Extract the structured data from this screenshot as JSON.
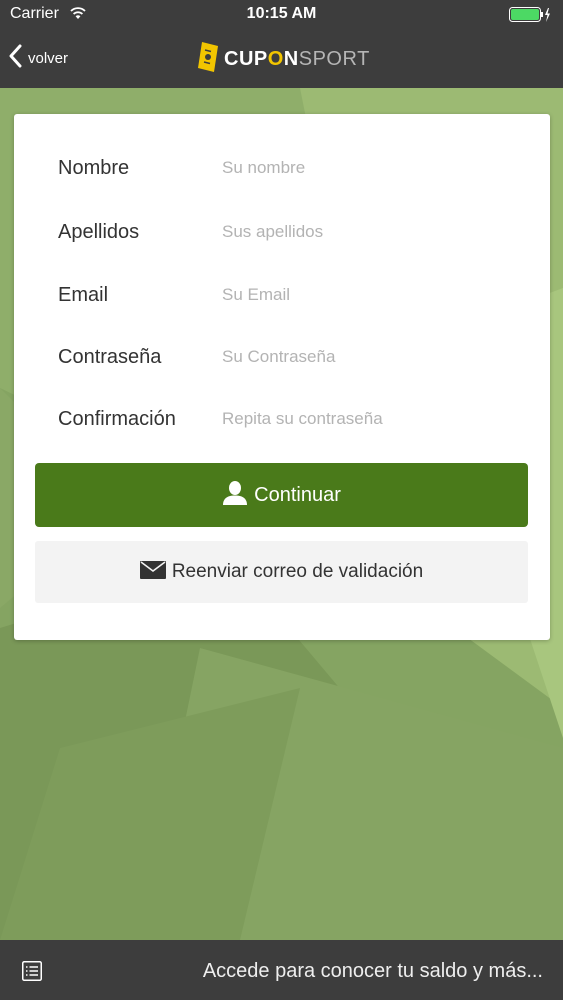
{
  "status_bar": {
    "carrier": "Carrier",
    "time": "10:15 AM"
  },
  "nav": {
    "back_label": "volver",
    "brand_part1": "CUP",
    "brand_o": "O",
    "brand_part2": "N",
    "brand_sport": "SPORT"
  },
  "form": {
    "fields": [
      {
        "label": "Nombre",
        "placeholder": "Su nombre"
      },
      {
        "label": "Apellidos",
        "placeholder": "Sus apellidos"
      },
      {
        "label": "Email",
        "placeholder": "Su Email"
      },
      {
        "label": "Contraseña",
        "placeholder": "Su Contraseña"
      },
      {
        "label": "Confirmación",
        "placeholder": "Repita su contraseña"
      }
    ],
    "continue_label": "Continuar",
    "resend_label": "Reenviar correo de validación"
  },
  "footer": {
    "text": "Accede para conocer tu saldo y más..."
  },
  "colors": {
    "bar": "#3d3d3d",
    "primary_button": "#4a7a1a",
    "secondary_button": "#f3f3f3",
    "brand_accent": "#f2c500",
    "battery": "#4cd964"
  }
}
